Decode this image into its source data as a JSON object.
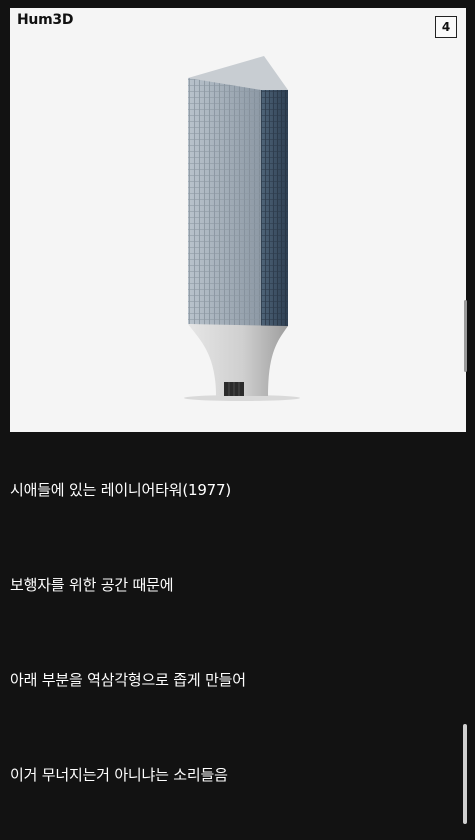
{
  "image": {
    "watermark": "Hum3D",
    "badge": "4",
    "subject": "tower-building"
  },
  "paragraphs": [
    "시애들에 있는 레이니어타워(1977)",
    "보행자를 위한 공간 때문에",
    "아래 부분을 역삼각형으로 좁게 만들어",
    "이거 무너지는거 아니냐는 소리들음"
  ],
  "colors": {
    "background": "#121212",
    "text": "#ffffff",
    "image_background": "#f5f5f5"
  }
}
